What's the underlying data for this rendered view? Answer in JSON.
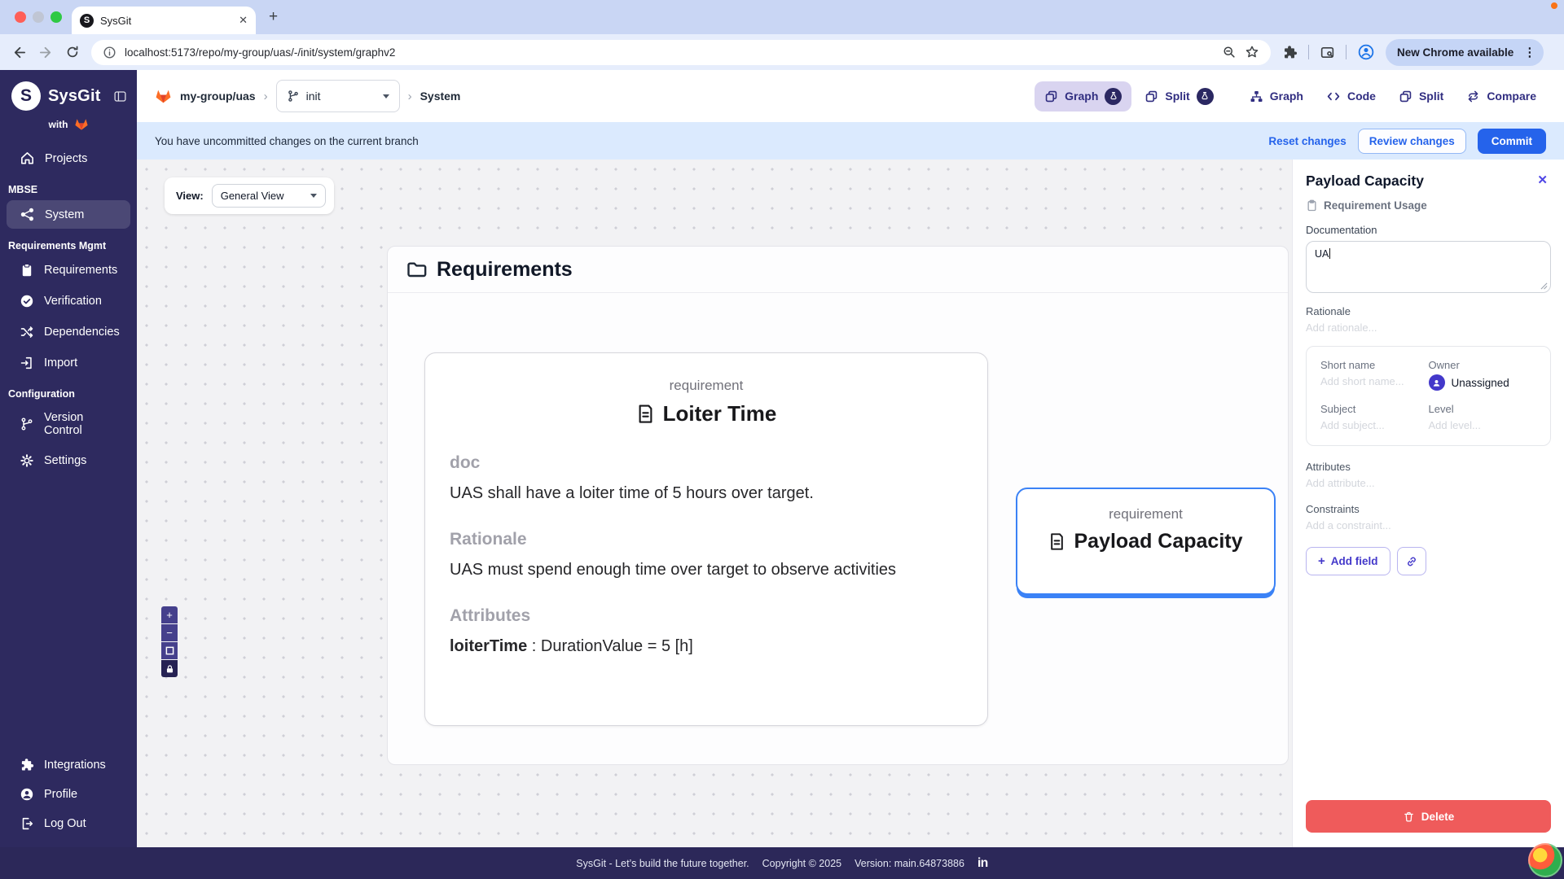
{
  "browser": {
    "tab_title": "SysGit",
    "url": "localhost:5173/repo/my-group/uas/-/init/system/graphv2",
    "update_label": "New Chrome available"
  },
  "breadcrumb": {
    "repo": "my-group/uas",
    "branch": "init",
    "page": "System"
  },
  "header_views": {
    "graph1": "Graph",
    "split1": "Split",
    "graph2": "Graph",
    "code": "Code",
    "split2": "Split",
    "compare": "Compare"
  },
  "notice": {
    "message": "You have uncommitted changes on the current branch",
    "reset": "Reset changes",
    "review": "Review changes",
    "commit": "Commit"
  },
  "sidebar": {
    "brand": "SysGit",
    "with_label": "with",
    "nav": {
      "projects": "Projects",
      "section_mbse": "MBSE",
      "system": "System",
      "section_reqmgmt": "Requirements Mgmt",
      "requirements": "Requirements",
      "verification": "Verification",
      "dependencies": "Dependencies",
      "import_item": "Import",
      "section_config": "Configuration",
      "version_control": "Version Control",
      "settings": "Settings",
      "integrations": "Integrations",
      "profile": "Profile",
      "logout": "Log Out"
    }
  },
  "canvas": {
    "view_label": "View:",
    "view_value": "General View",
    "container_title": "Requirements",
    "loiter": {
      "kind": "requirement",
      "title": "Loiter Time",
      "doc_heading": "doc",
      "doc_text": "UAS shall have a loiter time of 5 hours over target.",
      "rationale_heading": "Rationale",
      "rationale_text": "UAS must spend enough time over target to observe activities",
      "attributes_heading": "Attributes",
      "attribute_name": "loiterTime",
      "attribute_rest": " : DurationValue = 5 [h]"
    },
    "payload": {
      "kind": "requirement",
      "title": "Payload Capacity"
    }
  },
  "panel": {
    "title": "Payload Capacity",
    "type_label": "Requirement Usage",
    "documentation_label": "Documentation",
    "documentation_value": "UA",
    "rationale_label": "Rationale",
    "rationale_placeholder": "Add rationale...",
    "short_name_label": "Short name",
    "short_name_placeholder": "Add short name...",
    "owner_label": "Owner",
    "owner_value": "Unassigned",
    "subject_label": "Subject",
    "subject_placeholder": "Add subject...",
    "level_label": "Level",
    "level_placeholder": "Add level...",
    "attributes_label": "Attributes",
    "attributes_placeholder": "Add attribute...",
    "constraints_label": "Constraints",
    "constraints_placeholder": "Add a constraint...",
    "add_field_label": "Add field",
    "delete_label": "Delete"
  },
  "footer": {
    "tagline": "SysGit - Let’s build the future together.",
    "copyright": "Copyright © 2025",
    "version": "Version: main.64873886",
    "linkedin": "in"
  },
  "glyphs": {
    "close": "✕",
    "plus": "+",
    "minus": "−",
    "new_tab": "+",
    "crumb_sep": "›",
    "kebab": "⋮",
    "logo_letter": "S"
  },
  "colors": {
    "accent_indigo": "#312e81",
    "action_blue": "#2563eb",
    "selection_blue": "#3b82f6",
    "danger_red": "#ef5b5b",
    "sidebar_bg": "#2e2a5f",
    "notice_bg": "#dbeafe"
  }
}
